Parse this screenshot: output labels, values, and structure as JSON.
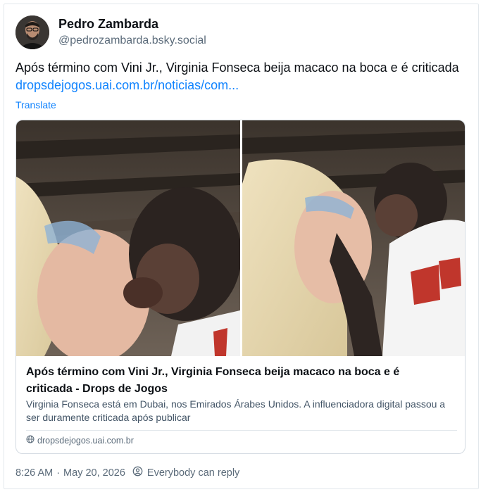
{
  "author": {
    "display_name": "Pedro Zambarda",
    "handle": "@pedrozambarda.bsky.social"
  },
  "post": {
    "text": "Após término com Vini Jr., Virginia Fonseca beija macaco na boca e é criticada ",
    "link_text": "dropsdejogos.uai.com.br/noticias/com...",
    "translate_label": "Translate"
  },
  "embed": {
    "title": "Após término com Vini Jr., Virginia Fonseca beija macaco na boca e é criticada - Drops de Jogos",
    "description": "Virginia Fonseca está em Dubai, nos Emirados Árabes Unidos. A influenciadora digital passou a ser duramente criticada após publicar",
    "domain": "dropsdejogos.uai.com.br"
  },
  "footer": {
    "time": "8:26 AM",
    "separator": "·",
    "date": "May 20, 2026",
    "reply_setting": "Everybody can reply"
  },
  "colors": {
    "link": "#1083fe",
    "muted": "#5b6b7a"
  },
  "icons": [
    "globe-icon",
    "reply-settings-icon"
  ]
}
